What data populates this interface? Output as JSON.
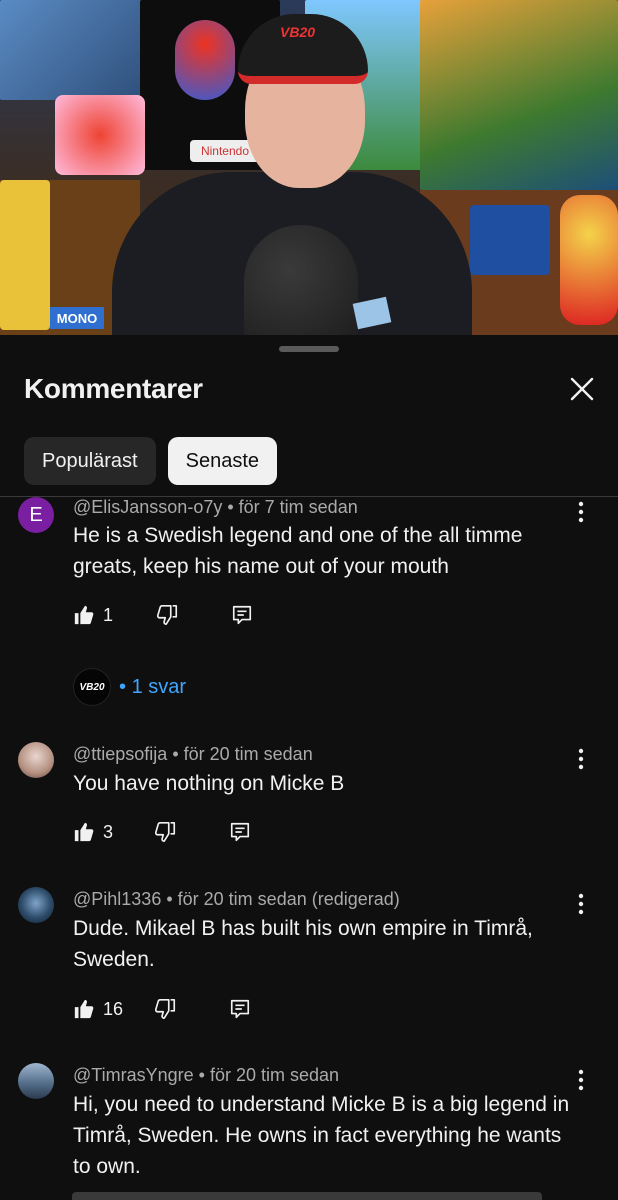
{
  "video": {
    "cap_logo": "VB20",
    "shelf_label": "MONO",
    "poster_label": "Nintendo"
  },
  "sheet": {
    "title": "Kommentarer",
    "filters": [
      {
        "label": "Populärast",
        "selected": false
      },
      {
        "label": "Senaste",
        "selected": true
      }
    ]
  },
  "comments": [
    {
      "avatar_letter": "E",
      "author": "@ElisJansson-o7y",
      "time": "för 7 tim sedan",
      "text": "He is a Swedish legend and one of the all timme greats, keep his name out of your mouth",
      "likes": "1",
      "replies": "1 svar",
      "reply_avatar_label": "VB20"
    },
    {
      "author": "@ttiepsofija",
      "time": "för 20 tim sedan",
      "text": "You have nothing on Micke B",
      "likes": "3"
    },
    {
      "author": "@Pihl1336",
      "time": "för 20 tim sedan (redigerad)",
      "text": "Dude. Mikael B has built his own empire in Timrå, Sweden.",
      "likes": "16"
    },
    {
      "author": "@TimrasYngre",
      "time": "för 20 tim sedan",
      "text": "Hi, you need to understand Micke B is a big legend in Timrå, Sweden. He owns in fact everything he wants to own."
    }
  ],
  "colors": {
    "background": "#0f0f0f",
    "link_blue": "#3ea6ff",
    "meta_gray": "#aaaaaa",
    "avatar_purple": "#7b1fa2"
  },
  "icons": [
    "close-icon",
    "like-icon",
    "dislike-icon",
    "reply-icon",
    "more-vert-icon"
  ]
}
